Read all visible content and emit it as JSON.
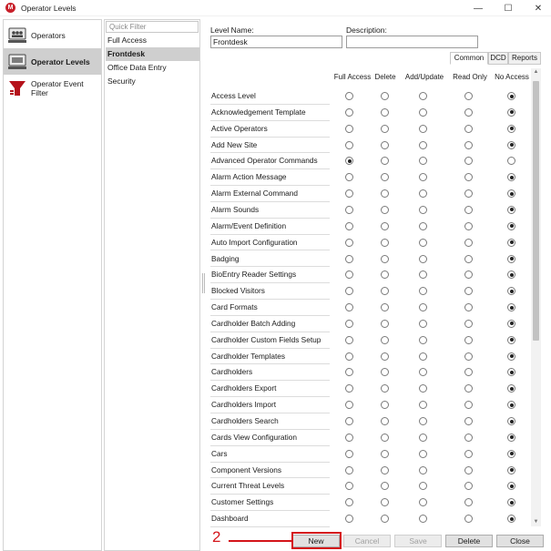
{
  "window": {
    "title": "Operator Levels",
    "app_icon_letter": "M",
    "minimize_glyph": "—",
    "maximize_glyph": "☐",
    "close_glyph": "✕"
  },
  "colors": {
    "accent_red": "#c8202a",
    "annotation_red": "#d4141a",
    "selected_bg": "#cfcfcf"
  },
  "left_nav": {
    "items": [
      {
        "label": "Operators",
        "icon": "operators-icon",
        "selected": false
      },
      {
        "label": "Operator Levels",
        "icon": "operator-levels-icon",
        "selected": true
      },
      {
        "label": "Operator Event Filter",
        "icon": "event-filter-icon",
        "selected": false
      }
    ]
  },
  "levels": {
    "quick_filter_placeholder": "Quick Filter",
    "items": [
      {
        "label": "Full Access",
        "selected": false
      },
      {
        "label": "Frontdesk",
        "selected": true
      },
      {
        "label": "Office Data Entry",
        "selected": false
      },
      {
        "label": "Security",
        "selected": false
      }
    ]
  },
  "details": {
    "level_name_label": "Level Name:",
    "level_name_value": "Frontdesk",
    "description_label": "Description:",
    "description_value": ""
  },
  "tabs": [
    {
      "label": "Common",
      "active": true
    },
    {
      "label": "DCD",
      "active": false
    },
    {
      "label": "Reports",
      "active": false
    }
  ],
  "columns": [
    "Full Access",
    "Delete",
    "Add/Update",
    "Read Only",
    "No Access"
  ],
  "permissions": [
    {
      "name": "Access Level",
      "selected": "No Access"
    },
    {
      "name": "Acknowledgement Template",
      "selected": "No Access"
    },
    {
      "name": "Active Operators",
      "selected": "No Access"
    },
    {
      "name": "Add New Site",
      "selected": "No Access"
    },
    {
      "name": "Advanced Operator Commands",
      "selected": "Full Access"
    },
    {
      "name": "Alarm Action Message",
      "selected": "No Access"
    },
    {
      "name": "Alarm External Command",
      "selected": "No Access"
    },
    {
      "name": "Alarm Sounds",
      "selected": "No Access"
    },
    {
      "name": "Alarm/Event Definition",
      "selected": "No Access"
    },
    {
      "name": "Auto Import Configuration",
      "selected": "No Access"
    },
    {
      "name": "Badging",
      "selected": "No Access"
    },
    {
      "name": "BioEntry Reader Settings",
      "selected": "No Access"
    },
    {
      "name": "Blocked Visitors",
      "selected": "No Access"
    },
    {
      "name": "Card Formats",
      "selected": "No Access"
    },
    {
      "name": "Cardholder Batch Adding",
      "selected": "No Access"
    },
    {
      "name": "Cardholder Custom Fields Setup",
      "selected": "No Access"
    },
    {
      "name": "Cardholder Templates",
      "selected": "No Access"
    },
    {
      "name": "Cardholders",
      "selected": "No Access"
    },
    {
      "name": "Cardholders Export",
      "selected": "No Access"
    },
    {
      "name": "Cardholders Import",
      "selected": "No Access"
    },
    {
      "name": "Cardholders Search",
      "selected": "No Access"
    },
    {
      "name": "Cards View Configuration",
      "selected": "No Access"
    },
    {
      "name": "Cars",
      "selected": "No Access"
    },
    {
      "name": "Component Versions",
      "selected": "No Access"
    },
    {
      "name": "Current Threat Levels",
      "selected": "No Access"
    },
    {
      "name": "Customer Settings",
      "selected": "No Access"
    },
    {
      "name": "Dashboard",
      "selected": "No Access"
    }
  ],
  "buttons": [
    {
      "label": "New",
      "enabled": true
    },
    {
      "label": "Cancel",
      "enabled": false
    },
    {
      "label": "Save",
      "enabled": false
    },
    {
      "label": "Delete",
      "enabled": true
    },
    {
      "label": "Close",
      "enabled": true
    }
  ],
  "annotation": {
    "step_number": "2"
  }
}
